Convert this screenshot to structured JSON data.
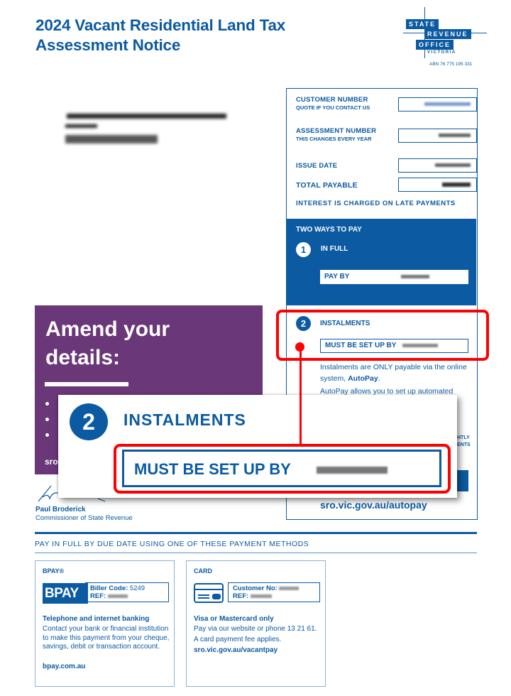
{
  "header": {
    "title_line1": "2024 Vacant Residential Land Tax",
    "title_line2": "Assessment Notice"
  },
  "logo": {
    "line1": "STATE",
    "line2": "REVENUE",
    "line3": "OFFICE",
    "line4": "VICTORIA",
    "abn": "ABN 76 775 195 331"
  },
  "info": {
    "customer_number_label": "CUSTOMER NUMBER",
    "customer_number_sub": "QUOTE IF YOU CONTACT US",
    "assessment_number_label": "ASSESSMENT NUMBER",
    "assessment_number_sub": "THIS CHANGES EVERY YEAR",
    "issue_date_label": "ISSUE DATE",
    "total_payable_label": "TOTAL PAYABLE",
    "interest_note": "INTEREST IS CHARGED ON LATE PAYMENTS"
  },
  "pay": {
    "heading": "TWO WAYS TO PAY",
    "option1_number": "1",
    "option1_label": "IN FULL",
    "pay_by_label": "PAY BY",
    "option2_number": "2",
    "option2_label": "INSTALMENTS",
    "must_setup_label": "MUST BE SET UP BY",
    "inst_text1_a": "Instalments are ONLY payable via the online system, ",
    "inst_text1_b": "AutoPay",
    "inst_text1_c": ".",
    "inst_text2": "AutoPay allows you to set up automated",
    "hidden_caps1": "HTLY",
    "hidden_caps2": "ENTS",
    "autopay_url": "sro.vic.gov.au/autopay"
  },
  "amend": {
    "heading_line1": "Amend your",
    "heading_line2": "details:",
    "link_partial": "sro"
  },
  "signature": {
    "name": "Paul Broderick",
    "title": "Commissioner of State Revenue"
  },
  "methods": {
    "heading": "PAY IN FULL BY DUE DATE USING ONE OF THESE PAYMENT METHODS",
    "bpay": {
      "title": "BPAY®",
      "logo_text": "BPAY",
      "biller_code_label": "Biller Code:",
      "biller_code": "5249",
      "ref_label": "REF:",
      "heading": "Telephone and internet banking",
      "text": "Contact your bank or financial institution to make this payment from your cheque, savings, debit or transaction account.",
      "link": "bpay.com.au"
    },
    "card": {
      "title": "CARD",
      "customer_no_label": "Customer No:",
      "ref_label": "REF:",
      "heading": "Visa or Mastercard only",
      "text1": "Pay via our website or phone 13 21 61.",
      "text2": "A card payment fee applies.",
      "link": "sro.vic.gov.au/vacantpay"
    }
  },
  "callout": {
    "number": "2",
    "label": "INSTALMENTS",
    "box_label": "MUST BE SET UP BY"
  },
  "colors": {
    "brand_blue": "#0b5aa2",
    "purple": "#6a3778",
    "highlight_red": "#ff0000"
  }
}
